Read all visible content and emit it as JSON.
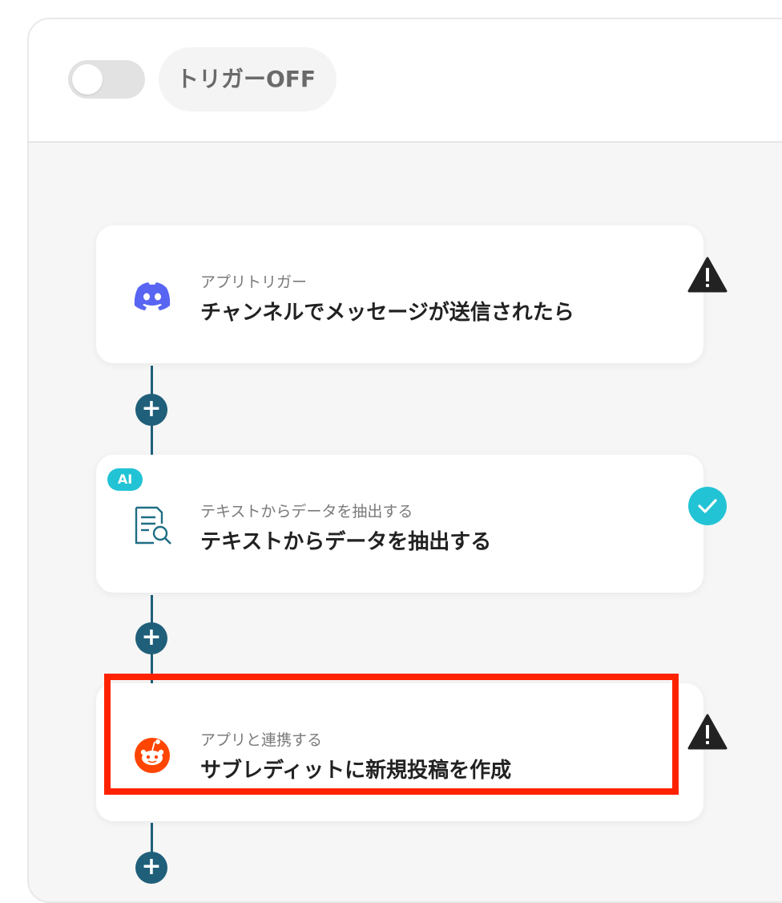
{
  "header": {
    "trigger_label": "トリガーOFF",
    "trigger_on": false
  },
  "steps": [
    {
      "subtitle": "アプリトリガー",
      "title": "チャンネルでメッセージが送信されたら",
      "icon": "discord-icon",
      "status": "warning",
      "ai_badge": ""
    },
    {
      "subtitle": "テキストからデータを抽出する",
      "title": "テキストからデータを抽出する",
      "icon": "document-search-icon",
      "status": "complete",
      "ai_badge": "AI"
    },
    {
      "subtitle": "アプリと連携する",
      "title": "サブレディットに新規投稿を作成",
      "icon": "reddit-icon",
      "status": "warning",
      "ai_badge": ""
    }
  ],
  "add_step_symbol": "+",
  "colors": {
    "connector": "#1f5f7a",
    "discord": "#5865f2",
    "reddit": "#ff4500",
    "check": "#22c3d4",
    "warning": "#222222",
    "highlight": "#ff2200"
  }
}
